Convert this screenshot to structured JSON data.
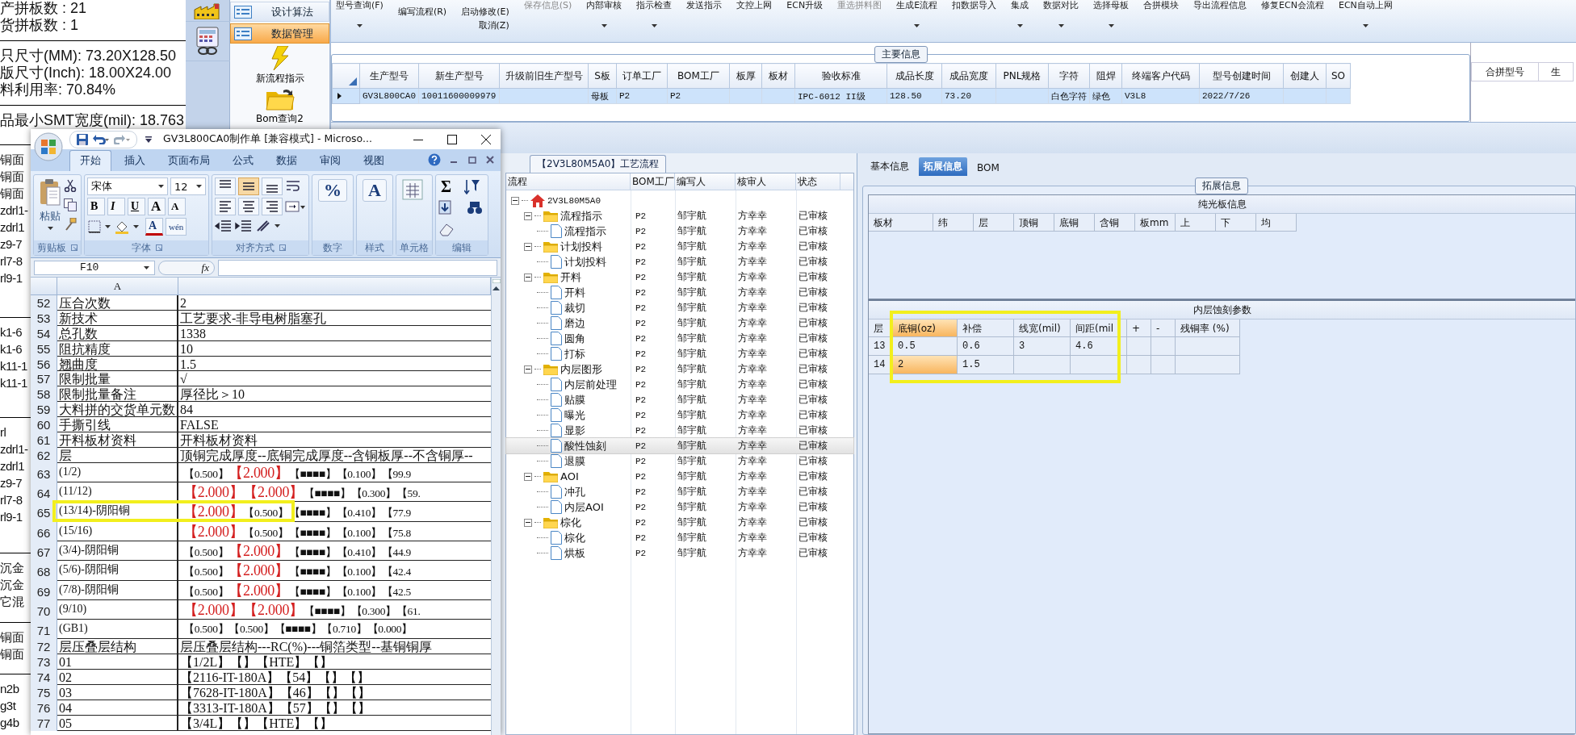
{
  "background_report": {
    "stats": [
      [
        "产拼板数 : 21",
        "货拼板数 : 1"
      ],
      [
        "只尺寸(MM): 73.20X128.50",
        "版尺寸(Inch): 18.00X24.00",
        "料利用率: 70.84%"
      ],
      [
        "品最小SMT宽度(mil): 18.763"
      ]
    ],
    "fragments": [
      [
        "铜面",
        "铜面",
        "铜面",
        "zdrl1-",
        "zdrl1",
        "z9-7",
        "rl7-8",
        "rl9-1"
      ],
      [
        "k1-6",
        "k1-6",
        "k11-1",
        "k11-1"
      ],
      [
        "rl",
        "zdrl1-",
        "zdrl1",
        "z9-7",
        "rl7-8",
        "rl9-1"
      ],
      [
        "沉金",
        "沉金",
        "它混"
      ],
      [
        "铜面",
        "铜面"
      ],
      [
        "n2b",
        "g3t",
        "g4b"
      ]
    ]
  },
  "nav": {
    "items": [
      {
        "label": "设计算法",
        "kind": "list",
        "selected": false
      },
      {
        "label": "数据管理",
        "kind": "list",
        "selected": true
      },
      {
        "label": "新流程指示",
        "kind": "lightning"
      },
      {
        "label": "Bom查询2",
        "kind": "folder"
      }
    ]
  },
  "toolbar": [
    {
      "kind": "large",
      "label": "型号查询(F)",
      "dropdown": true,
      "disabled": false
    },
    {
      "kind": "stack",
      "items": [
        {
          "label": "编写流程(R)"
        }
      ]
    },
    {
      "kind": "stack",
      "items": [
        {
          "label": "启动修改(E)"
        },
        {
          "label": "取消(Z)"
        }
      ]
    },
    {
      "kind": "large",
      "label": "保存信息(S)",
      "dropdown": false,
      "disabled": true
    },
    {
      "kind": "large",
      "label": "内部审核",
      "dropdown": true,
      "disabled": false
    },
    {
      "kind": "large",
      "label": "指示检查",
      "dropdown": true,
      "disabled": false
    },
    {
      "kind": "large",
      "label": "发送指示",
      "dropdown": false,
      "disabled": false
    },
    {
      "kind": "large",
      "label": "文控上网",
      "dropdown": false,
      "disabled": false
    },
    {
      "kind": "large",
      "label": "ECN升级",
      "dropdown": false,
      "disabled": false
    },
    {
      "kind": "large",
      "label": "重选拼料图",
      "dropdown": false,
      "disabled": true
    },
    {
      "kind": "large",
      "label": "生成E流程",
      "dropdown": true,
      "disabled": false
    },
    {
      "kind": "large",
      "label": "扣数据导入",
      "dropdown": false,
      "disabled": false
    },
    {
      "kind": "large",
      "label": "集成",
      "dropdown": true,
      "disabled": false
    },
    {
      "kind": "large",
      "label": "数据对比",
      "dropdown": true,
      "disabled": false
    },
    {
      "kind": "large",
      "label": "选择母板",
      "dropdown": true,
      "disabled": false
    },
    {
      "kind": "large",
      "label": "合拼模块",
      "dropdown": false,
      "disabled": false
    },
    {
      "kind": "large",
      "label": "导出流程信息",
      "dropdown": false,
      "disabled": false
    },
    {
      "kind": "large",
      "label": "修复ECN会流程",
      "dropdown": false,
      "disabled": false
    },
    {
      "kind": "large",
      "label": "ECN自动上网",
      "dropdown": true,
      "disabled": false
    }
  ],
  "main_info": {
    "title": "主要信息",
    "columns": [
      "生产型号",
      "新生产型号",
      "升级前旧生产型号",
      "S板",
      "订单工厂",
      "BOM工厂",
      "板厚",
      "板材",
      "验收标准",
      "成品长度",
      "成品宽度",
      "PNL规格",
      "字符",
      "阻焊",
      "终端客户代码",
      "型号创建时间",
      "创建人",
      "SO"
    ],
    "rows": [
      {
        "selected": true,
        "cells": [
          "GV3L800CA0",
          "10011600009979",
          null,
          "母板",
          "P2",
          "P2",
          null,
          null,
          "IPC-6012 II级",
          "128.50",
          "73.20",
          null,
          "白色字符",
          "绿色",
          "V3L8",
          "2022/7/26",
          null,
          null
        ]
      }
    ]
  },
  "merge_grid": {
    "columns": [
      "合拼型号",
      "生"
    ]
  },
  "process_flow": {
    "title": "【2V3L80M5A0】工艺流程",
    "columns": [
      "流程",
      "BOM工厂",
      "编写人",
      "核审人",
      "状态"
    ],
    "tree": [
      {
        "label": "2V3L80M5A0",
        "kind": "root",
        "expanded": true,
        "selected": false,
        "children": [
          {
            "label": "流程指示",
            "kind": "folder",
            "expanded": true,
            "selected": false,
            "factory": "P2",
            "writer": "邹宇航",
            "reviewer": "方幸幸",
            "status": "已审核",
            "children": [
              {
                "label": "流程指示",
                "kind": "file",
                "selected": false,
                "factory": "P2",
                "writer": "邹宇航",
                "reviewer": "方幸幸",
                "status": "已审核"
              }
            ]
          },
          {
            "label": "计划投料",
            "kind": "folder",
            "expanded": true,
            "selected": false,
            "factory": "P2",
            "writer": "邹宇航",
            "reviewer": "方幸幸",
            "status": "已审核",
            "children": [
              {
                "label": "计划投料",
                "kind": "file",
                "selected": false,
                "factory": "P2",
                "writer": "邹宇航",
                "reviewer": "方幸幸",
                "status": "已审核"
              }
            ]
          },
          {
            "label": "开料",
            "kind": "folder",
            "expanded": true,
            "selected": false,
            "factory": "P2",
            "writer": "邹宇航",
            "reviewer": "方幸幸",
            "status": "已审核",
            "children": [
              {
                "label": "开料",
                "kind": "file",
                "selected": false,
                "factory": "P2",
                "writer": "邹宇航",
                "reviewer": "方幸幸",
                "status": "已审核"
              },
              {
                "label": "裁切",
                "kind": "file",
                "selected": false,
                "factory": "P2",
                "writer": "邹宇航",
                "reviewer": "方幸幸",
                "status": "已审核"
              },
              {
                "label": "磨边",
                "kind": "file",
                "selected": false,
                "factory": "P2",
                "writer": "邹宇航",
                "reviewer": "方幸幸",
                "status": "已审核"
              },
              {
                "label": "圆角",
                "kind": "file",
                "selected": false,
                "factory": "P2",
                "writer": "邹宇航",
                "reviewer": "方幸幸",
                "status": "已审核"
              },
              {
                "label": "打标",
                "kind": "file",
                "selected": false,
                "factory": "P2",
                "writer": "邹宇航",
                "reviewer": "方幸幸",
                "status": "已审核"
              }
            ]
          },
          {
            "label": "内层图形",
            "kind": "folder",
            "expanded": true,
            "selected": false,
            "factory": "P2",
            "writer": "邹宇航",
            "reviewer": "方幸幸",
            "status": "已审核",
            "children": [
              {
                "label": "内层前处理",
                "kind": "file",
                "selected": false,
                "factory": "P2",
                "writer": "邹宇航",
                "reviewer": "方幸幸",
                "status": "已审核"
              },
              {
                "label": "贴膜",
                "kind": "file",
                "selected": false,
                "factory": "P2",
                "writer": "邹宇航",
                "reviewer": "方幸幸",
                "status": "已审核"
              },
              {
                "label": "曝光",
                "kind": "file",
                "selected": false,
                "factory": "P2",
                "writer": "邹宇航",
                "reviewer": "方幸幸",
                "status": "已审核"
              },
              {
                "label": "显影",
                "kind": "file",
                "selected": false,
                "factory": "P2",
                "writer": "邹宇航",
                "reviewer": "方幸幸",
                "status": "已审核"
              },
              {
                "label": "酸性蚀刻",
                "kind": "file",
                "selected": true,
                "factory": "P2",
                "writer": "邹宇航",
                "reviewer": "方幸幸",
                "status": "已审核"
              },
              {
                "label": "退膜",
                "kind": "file",
                "selected": false,
                "factory": "P2",
                "writer": "邹宇航",
                "reviewer": "方幸幸",
                "status": "已审核"
              }
            ]
          },
          {
            "label": "AOI",
            "kind": "folder",
            "expanded": true,
            "selected": false,
            "factory": "P2",
            "writer": "邹宇航",
            "reviewer": "方幸幸",
            "status": "已审核",
            "children": [
              {
                "label": "冲孔",
                "kind": "file",
                "selected": false,
                "factory": "P2",
                "writer": "邹宇航",
                "reviewer": "方幸幸",
                "status": "已审核"
              },
              {
                "label": "内层AOI",
                "kind": "file",
                "selected": false,
                "factory": "P2",
                "writer": "邹宇航",
                "reviewer": "方幸幸",
                "status": "已审核"
              }
            ]
          },
          {
            "label": "棕化",
            "kind": "folder",
            "expanded": true,
            "selected": false,
            "factory": "P2",
            "writer": "邹宇航",
            "reviewer": "方幸幸",
            "status": "已审核",
            "children": [
              {
                "label": "棕化",
                "kind": "file",
                "selected": false,
                "factory": "P2",
                "writer": "邹宇航",
                "reviewer": "方幸幸",
                "status": "已审核"
              },
              {
                "label": "烘板",
                "kind": "file",
                "selected": false,
                "factory": "P2",
                "writer": "邹宇航",
                "reviewer": "方幸幸",
                "status": "已审核"
              }
            ]
          }
        ]
      }
    ]
  },
  "detail_tabs": [
    {
      "label": "基本信息",
      "selected": false
    },
    {
      "label": "拓展信息",
      "selected": true
    },
    {
      "label": "BOM",
      "selected": false
    }
  ],
  "extended_info": {
    "title": "拓展信息",
    "bare_board": {
      "title": "纯光板信息",
      "columns": [
        "板材",
        "纬",
        "层",
        "顶铜",
        "底铜",
        "含铜",
        "板mm",
        "上",
        "下",
        "均"
      ]
    },
    "etch_params": {
      "title": "内层蚀刻参数",
      "highlighted": true,
      "columns": [
        {
          "label": "层",
          "selected": false
        },
        {
          "label": "底铜(oz)",
          "selected": true
        },
        {
          "label": "补偿",
          "selected": false
        },
        {
          "label": "线宽(mil)",
          "selected": false
        },
        {
          "label": "间距(mil",
          "selected": false
        },
        {
          "label": "+",
          "selected": false
        },
        {
          "label": "-",
          "selected": false
        },
        {
          "label": "残铜率 (%)",
          "selected": false
        }
      ],
      "rows": [
        {
          "cells": [
            {
              "text": "13",
              "selected": false
            },
            {
              "text": "0.5",
              "selected": false
            },
            {
              "text": "0.6",
              "selected": false
            },
            {
              "text": "3",
              "selected": false
            },
            {
              "text": "4.6",
              "selected": false
            },
            null,
            null,
            null
          ]
        },
        {
          "cells": [
            {
              "text": "14",
              "selected": false
            },
            {
              "text": "2",
              "selected": true
            },
            {
              "text": "1.5",
              "selected": false
            },
            null,
            null,
            null,
            null,
            null
          ]
        }
      ]
    }
  },
  "excel": {
    "title": "GV3L800CA0制作单  [兼容模式] - Microso...",
    "tabs": [
      {
        "label": "开始",
        "selected": true
      },
      {
        "label": "插入",
        "selected": false
      },
      {
        "label": "页面布局",
        "selected": false
      },
      {
        "label": "公式",
        "selected": false
      },
      {
        "label": "数据",
        "selected": false
      },
      {
        "label": "审阅",
        "selected": false
      },
      {
        "label": "视图",
        "selected": false
      }
    ],
    "ribbon": [
      {
        "kind": "clipboard",
        "label": "剪贴板",
        "button": "粘贴"
      },
      {
        "kind": "font",
        "label": "字体",
        "font_name": "宋体",
        "font_size": "12",
        "style_buttons": [
          "B",
          "I",
          "U"
        ],
        "size_buttons": [
          "A",
          "A"
        ],
        "color_letter": "A",
        "phonetic": "wén"
      },
      {
        "kind": "alignment",
        "label": "对齐方式",
        "vertical": [
          {
            "selected": false
          },
          {
            "selected": true
          },
          {
            "selected": false
          }
        ]
      },
      {
        "kind": "big",
        "label": "数字",
        "symbol": "%"
      },
      {
        "kind": "big",
        "label": "样式",
        "symbol": "A"
      },
      {
        "kind": "cells",
        "label": "单元格"
      },
      {
        "kind": "editing",
        "label": "编辑",
        "symbol": "Σ"
      }
    ],
    "name_box": "F10",
    "formula_label": "fx",
    "column_header": "A",
    "rows": [
      {
        "number": "52",
        "a": "压合次数",
        "kind": "plain",
        "b": "2",
        "highlighted": false
      },
      {
        "number": "53",
        "a": "新技术",
        "kind": "plain",
        "b": "工艺要求-非导电树脂塞孔",
        "highlighted": false
      },
      {
        "number": "54",
        "a": "总孔数",
        "kind": "plain",
        "b": "1338",
        "highlighted": false
      },
      {
        "number": "55",
        "a": "阻抗精度",
        "kind": "plain",
        "b": "10",
        "highlighted": false
      },
      {
        "number": "56",
        "a": "翘曲度",
        "kind": "plain",
        "b": "1.5",
        "highlighted": false
      },
      {
        "number": "57",
        "a": "限制批量",
        "kind": "plain",
        "b": "√",
        "highlighted": false
      },
      {
        "number": "58",
        "a": "限制批量备注",
        "kind": "plain",
        "b": "厚径比＞10",
        "highlighted": false
      },
      {
        "number": "59",
        "a": "大料拼的交货单元数",
        "kind": "plain",
        "b": "84",
        "highlighted": false
      },
      {
        "number": "60",
        "a": "手撕引线",
        "kind": "plain",
        "b": "FALSE",
        "highlighted": false
      },
      {
        "number": "61",
        "a": "开料板材资料",
        "kind": "plain",
        "b": "开料板材资料",
        "highlighted": false
      },
      {
        "number": "62",
        "a": "层",
        "kind": "plain",
        "b": "顶铜完成厚度--底铜完成厚度--含铜板厚--不含铜厚--",
        "highlighted": false
      },
      {
        "number": "63",
        "a": "(1/2)",
        "kind": "layer",
        "highlighted": false,
        "b": [
          {
            "text": "【0.500】",
            "red": false
          },
          {
            "text": "【2.000】",
            "red": true
          },
          {
            "text": "【■■■■】",
            "red": false
          },
          {
            "text": "【0.100】",
            "red": false
          },
          {
            "text": "【99.9",
            "red": false
          }
        ]
      },
      {
        "number": "64",
        "a": "(11/12)",
        "kind": "layer",
        "highlighted": false,
        "b": [
          {
            "text": "【2.000】",
            "red": true
          },
          {
            "text": "【2.000】",
            "red": true
          },
          {
            "text": "【■■■■】",
            "red": false
          },
          {
            "text": "【0.300】",
            "red": false
          },
          {
            "text": "【59.",
            "red": false
          }
        ]
      },
      {
        "number": "65",
        "a": "(13/14)-阴阳铜",
        "kind": "layer",
        "highlighted": true,
        "b": [
          {
            "text": "【2.000】",
            "red": true
          },
          {
            "text": "【0.500】",
            "red": false
          },
          {
            "text": "【■■■■】",
            "red": false
          },
          {
            "text": "【0.410】",
            "red": false
          },
          {
            "text": "【77.9",
            "red": false
          }
        ]
      },
      {
        "number": "66",
        "a": "(15/16)",
        "kind": "layer",
        "highlighted": false,
        "b": [
          {
            "text": "【2.000】",
            "red": true
          },
          {
            "text": "【0.500】",
            "red": false
          },
          {
            "text": "【■■■■】",
            "red": false
          },
          {
            "text": "【0.100】",
            "red": false
          },
          {
            "text": "【75.8",
            "red": false
          }
        ]
      },
      {
        "number": "67",
        "a": "(3/4)-阴阳铜",
        "kind": "layer",
        "highlighted": false,
        "b": [
          {
            "text": "【0.500】",
            "red": false
          },
          {
            "text": "【2.000】",
            "red": true
          },
          {
            "text": "【■■■■】",
            "red": false
          },
          {
            "text": "【0.410】",
            "red": false
          },
          {
            "text": "【44.9",
            "red": false
          }
        ]
      },
      {
        "number": "68",
        "a": "(5/6)-阴阳铜",
        "kind": "layer",
        "highlighted": false,
        "b": [
          {
            "text": "【0.500】",
            "red": false
          },
          {
            "text": "【2.000】",
            "red": true
          },
          {
            "text": "【■■■■】",
            "red": false
          },
          {
            "text": "【0.100】",
            "red": false
          },
          {
            "text": "【42.4",
            "red": false
          }
        ]
      },
      {
        "number": "69",
        "a": "(7/8)-阴阳铜",
        "kind": "layer",
        "highlighted": false,
        "b": [
          {
            "text": "【0.500】",
            "red": false
          },
          {
            "text": "【2.000】",
            "red": true
          },
          {
            "text": "【■■■■】",
            "red": false
          },
          {
            "text": "【0.100】",
            "red": false
          },
          {
            "text": "【42.5",
            "red": false
          }
        ]
      },
      {
        "number": "70",
        "a": "(9/10)",
        "kind": "layer",
        "highlighted": false,
        "b": [
          {
            "text": "【2.000】",
            "red": true
          },
          {
            "text": "【2.000】",
            "red": true
          },
          {
            "text": "【■■■■】",
            "red": false
          },
          {
            "text": "【0.300】",
            "red": false
          },
          {
            "text": "【61.",
            "red": false
          }
        ]
      },
      {
        "number": "71",
        "a": "(GB1)",
        "kind": "layer",
        "highlighted": false,
        "b": [
          {
            "text": "【0.500】",
            "red": false
          },
          {
            "text": "【0.500】",
            "red": false
          },
          {
            "text": "【■■■■】",
            "red": false
          },
          {
            "text": "【0.710】",
            "red": false
          },
          {
            "text": "【0.000】",
            "red": false
          }
        ]
      },
      {
        "number": "72",
        "a": "层压叠层结构",
        "kind": "plain",
        "b": "层压叠层结构---RC(%)---铜箔类型--基铜铜厚",
        "highlighted": false
      },
      {
        "number": "73",
        "a": "01",
        "kind": "plain",
        "b": "【1/2L】【】【HTE】【】",
        "highlighted": false
      },
      {
        "number": "74",
        "a": "02",
        "kind": "plain",
        "b": "【2116-IT-180A】【54】【】【】",
        "highlighted": false
      },
      {
        "number": "75",
        "a": "03",
        "kind": "plain",
        "b": "【7628-IT-180A】【46】【】【】",
        "highlighted": false
      },
      {
        "number": "76",
        "a": "04",
        "kind": "plain",
        "b": "【3313-IT-180A】【57】【】【】",
        "highlighted": false
      },
      {
        "number": "77",
        "a": "05",
        "kind": "plain",
        "b": "【3/4L】【】【HTE】【】",
        "highlighted": false
      }
    ]
  }
}
